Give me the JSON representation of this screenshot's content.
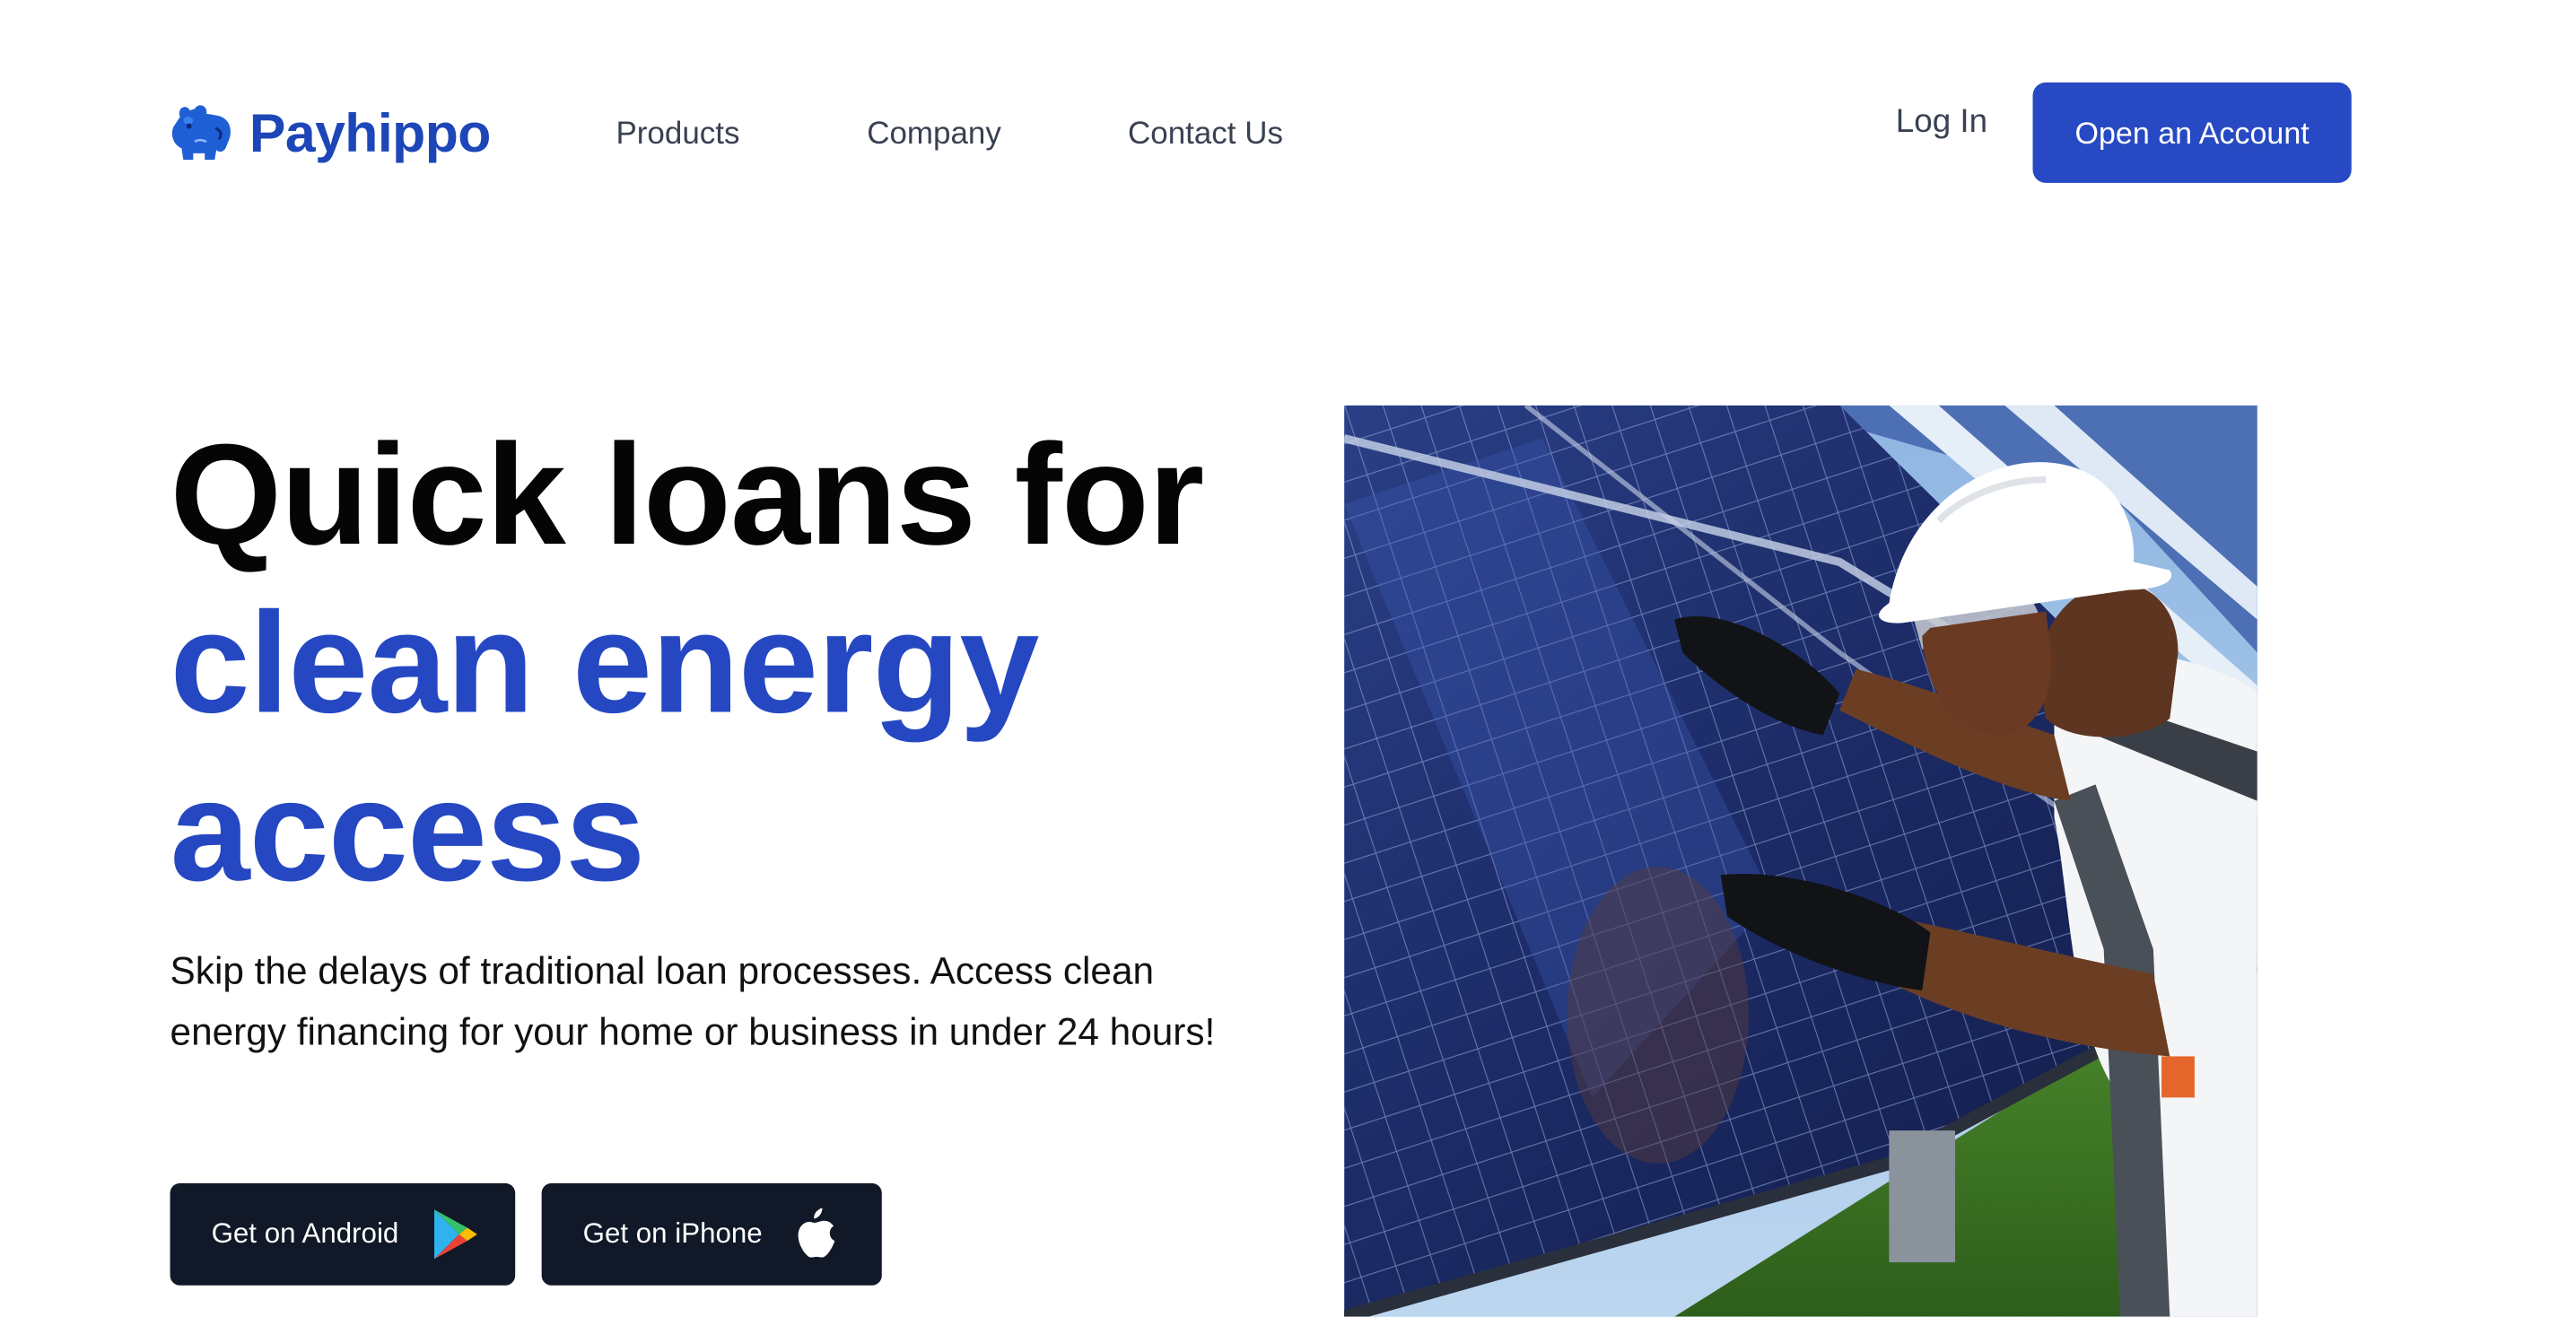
{
  "brand": {
    "name": "Payhippo",
    "logo_icon": "hippo-logo-icon",
    "color": "#1d46b8"
  },
  "nav": {
    "items": [
      {
        "label": "Products"
      },
      {
        "label": "Company"
      },
      {
        "label": "Contact Us"
      }
    ],
    "login_label": "Log In",
    "cta_label": "Open an Account"
  },
  "hero": {
    "headline_line1": "Quick loans for",
    "headline_line2": "clean energy",
    "headline_line3": "access",
    "subcopy": "Skip the delays of traditional loan processes. Access clean energy financing for your home or business in under 24 hours!",
    "buttons": {
      "android": {
        "label": "Get on Android",
        "icon": "google-play-icon"
      },
      "iphone": {
        "label": "Get on iPhone",
        "icon": "apple-icon"
      }
    },
    "image_icon": "solar-panel-worker-photo"
  },
  "colors": {
    "accent": "#2548c2",
    "button_primary": "#2749c3",
    "store_button": "#111827",
    "nav_text": "#394152"
  }
}
